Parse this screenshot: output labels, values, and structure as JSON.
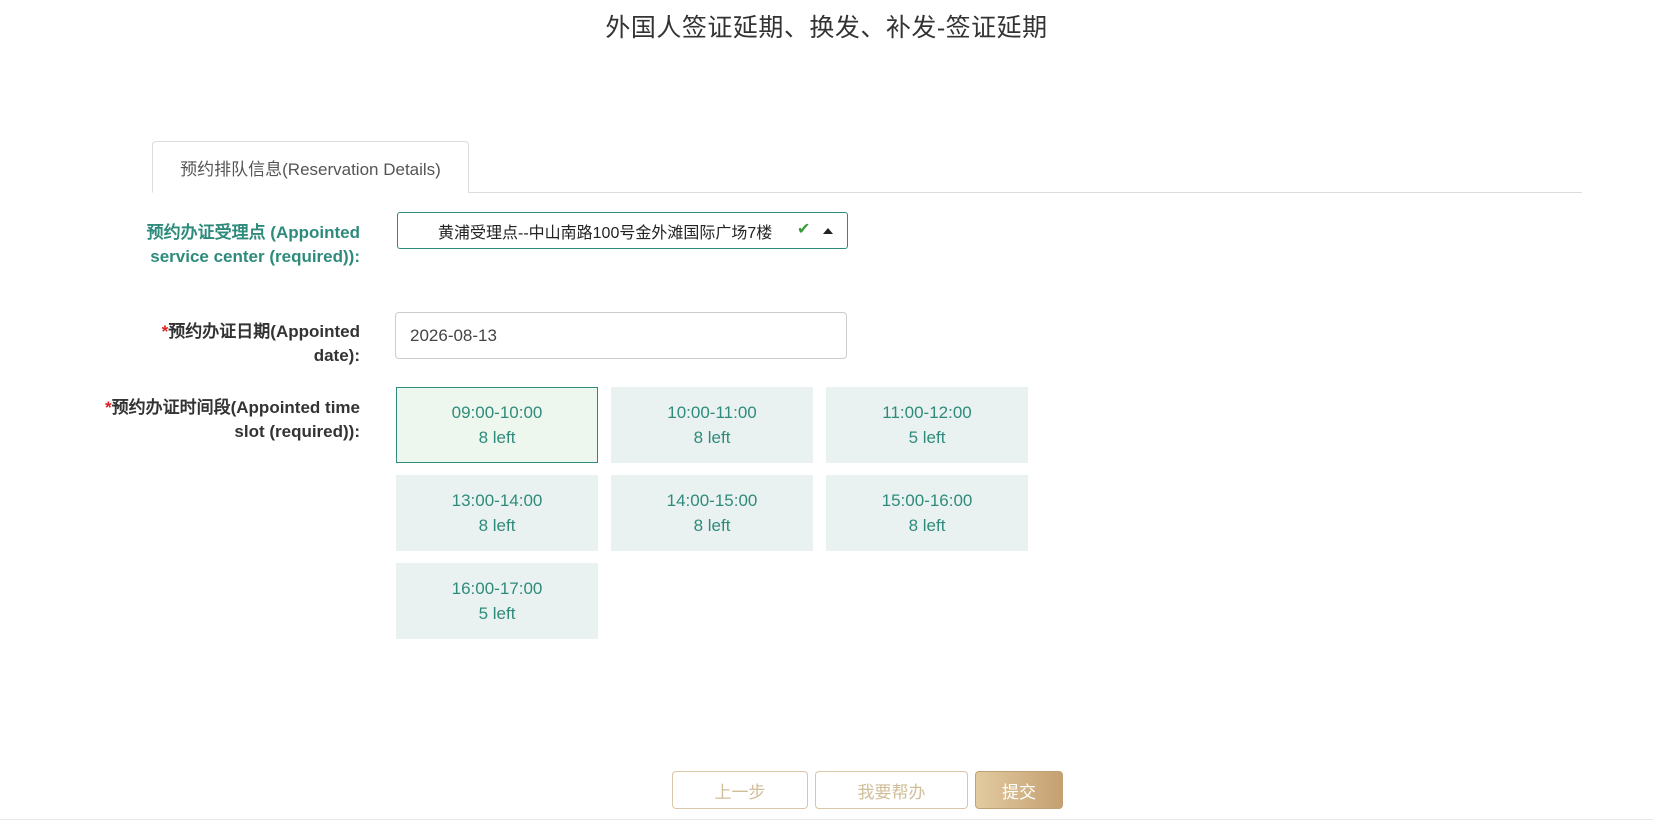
{
  "page": {
    "title": "外国人签证延期、换发、补发-签证延期"
  },
  "tabs": [
    {
      "label": "预约排队信息(Reservation Details)"
    }
  ],
  "form": {
    "service_center": {
      "label": "预约办证受理点 (Appointed service center (required)):",
      "value": "黄浦受理点--中山南路100号金外滩国际广场7楼"
    },
    "date": {
      "required_mark": "*",
      "label": "预约办证日期(Appointed date):",
      "value": "2026-08-13"
    },
    "time_slot": {
      "required_mark": "*",
      "label": "预约办证时间段(Appointed time slot (required)):",
      "options": [
        {
          "time": "09:00-10:00",
          "remaining": "8 left",
          "selected": true
        },
        {
          "time": "10:00-11:00",
          "remaining": "8 left",
          "selected": false
        },
        {
          "time": "11:00-12:00",
          "remaining": "5 left",
          "selected": false
        },
        {
          "time": "13:00-14:00",
          "remaining": "8 left",
          "selected": false
        },
        {
          "time": "14:00-15:00",
          "remaining": "8 left",
          "selected": false
        },
        {
          "time": "15:00-16:00",
          "remaining": "8 left",
          "selected": false
        },
        {
          "time": "16:00-17:00",
          "remaining": "5 left",
          "selected": false
        }
      ]
    }
  },
  "buttons": {
    "prev": "上一步",
    "help": "我要帮办",
    "submit": "提交"
  },
  "colors": {
    "accent": "#2e8b7c",
    "required": "#e02020",
    "gold": "#c4a072"
  }
}
